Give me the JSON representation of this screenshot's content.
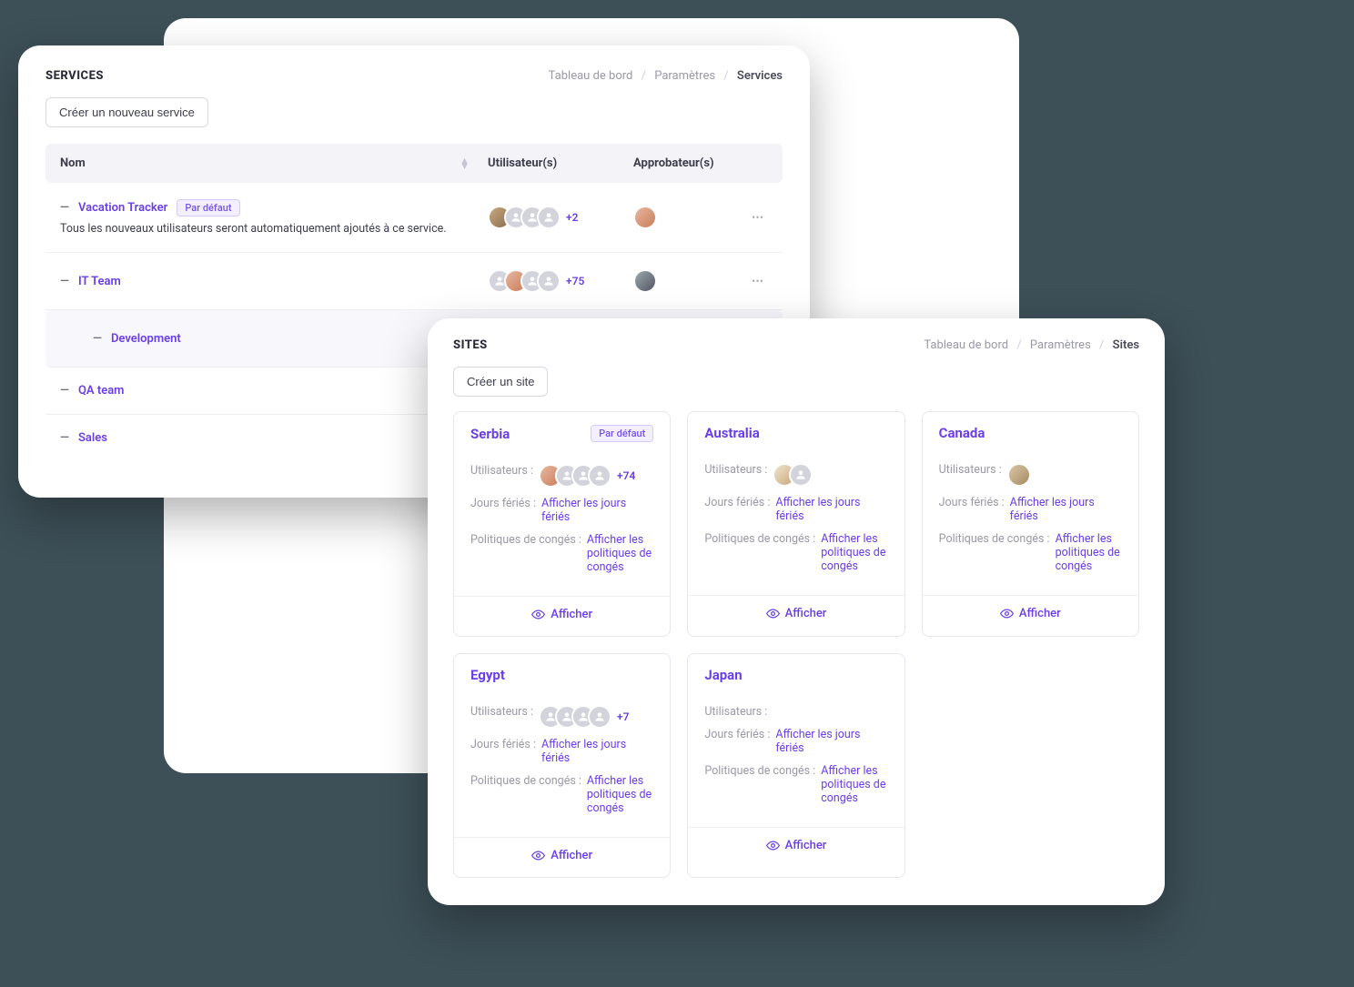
{
  "services": {
    "title": "SERVICES",
    "breadcrumb": {
      "a": "Tableau de bord",
      "b": "Paramètres",
      "c": "Services"
    },
    "create_btn": "Créer un nouveau service",
    "cols": {
      "name": "Nom",
      "users": "Utilisateur(s)",
      "approvers": "Approbateur(s)"
    },
    "default_badge": "Par défaut",
    "rows": [
      {
        "name": "Vacation Tracker",
        "default": true,
        "sub": "Tous les nouveaux utilisateurs seront automatiquement ajoutés à ce service.",
        "extra": "+2"
      },
      {
        "name": "IT Team",
        "extra": "+75"
      },
      {
        "name": "Development",
        "indent": true
      },
      {
        "name": "QA team"
      },
      {
        "name": "Sales"
      }
    ]
  },
  "sites": {
    "title": "SITES",
    "breadcrumb": {
      "a": "Tableau de bord",
      "b": "Paramètres",
      "c": "Sites"
    },
    "create_btn": "Créer un site",
    "labels": {
      "users": "Utilisateurs :",
      "holidays": "Jours fériés :",
      "holidays_link": "Afficher les jours fériés",
      "policies": "Politiques de congés :",
      "policies_link": "Afficher les politiques de congés",
      "view": "Afficher",
      "default": "Par défaut"
    },
    "cards": [
      {
        "name": "Serbia",
        "default": true,
        "extra": "+74"
      },
      {
        "name": "Australia"
      },
      {
        "name": "Canada"
      },
      {
        "name": "Egypt",
        "extra": "+7"
      },
      {
        "name": "Japan"
      }
    ]
  }
}
